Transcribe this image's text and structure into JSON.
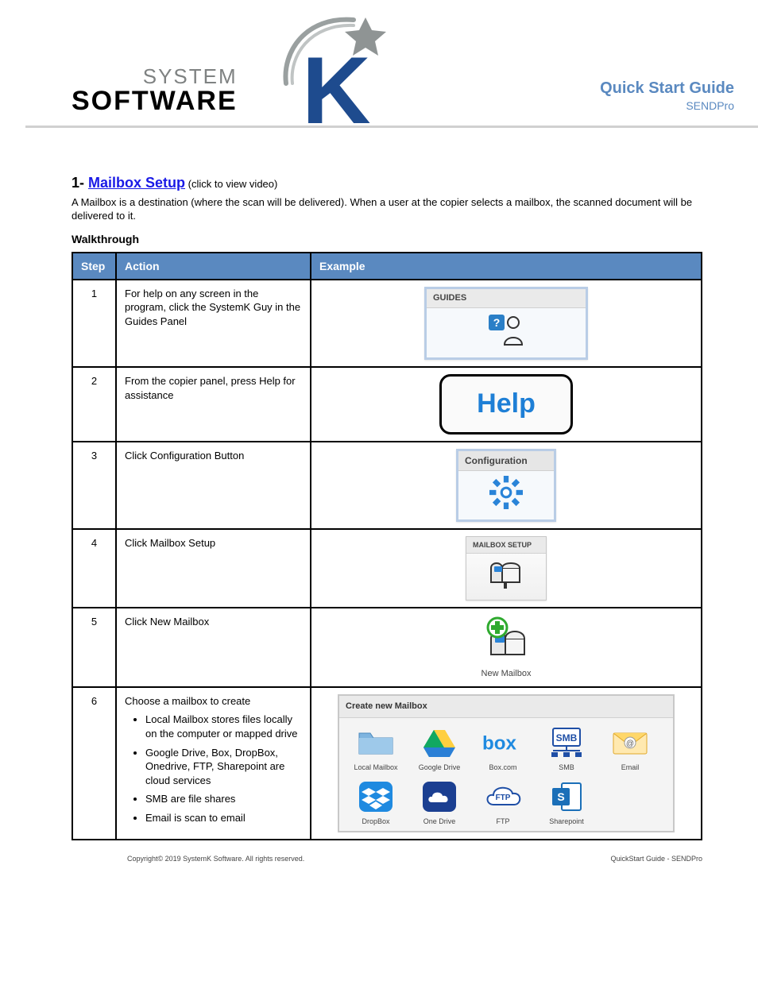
{
  "header": {
    "system": "SYSTEM",
    "software": "SOFTWARE",
    "doc_type": "Quick Start Guide",
    "product": "SENDPro"
  },
  "doc_title": {
    "prefix": "1- ",
    "link_text": "Mailbox Setup",
    "link_note": " (click to view video)"
  },
  "intro": "A Mailbox is a destination (where the scan will be delivered). When a user at the copier selects a mailbox, the scanned document will be delivered to it.",
  "section_heading": "Walkthrough",
  "table": {
    "headers": {
      "step": "Step",
      "action": "Action",
      "example": "Example"
    },
    "rows": [
      {
        "num": "1",
        "action": "For help on any screen in the program, click the SystemK Guy in the Guides Panel"
      },
      {
        "num": "2",
        "action": "From the copier panel, press Help for assistance"
      },
      {
        "num": "3",
        "action": "Click Configuration Button"
      },
      {
        "num": "4",
        "action": "Click Mailbox Setup"
      },
      {
        "num": "5",
        "action": "Click New Mailbox"
      },
      {
        "num": "6",
        "action_line": "Choose a mailbox to create",
        "bullets": [
          "Local Mailbox stores files locally on the computer or mapped drive",
          "Google Drive, Box, DropBox, Onedrive, FTP, Sharepoint are cloud services",
          "SMB are file shares",
          "Email is scan to email"
        ]
      }
    ]
  },
  "widgets": {
    "guides_label": "GUIDES",
    "help_label": "Help",
    "config_label": "Configuration",
    "mailbox_setup_label": "MAILBOX SETUP",
    "new_mailbox_label": "New Mailbox",
    "create_panel_title": "Create new Mailbox",
    "mailbox_types": [
      "Local Mailbox",
      "Google Drive",
      "Box.com",
      "SMB",
      "Email",
      "DropBox",
      "One Drive",
      "FTP",
      "Sharepoint"
    ]
  },
  "footer": {
    "copyright": "Copyright© 2019 SystemK Software. All rights reserved.",
    "right": "QuickStart Guide - SENDPro"
  }
}
